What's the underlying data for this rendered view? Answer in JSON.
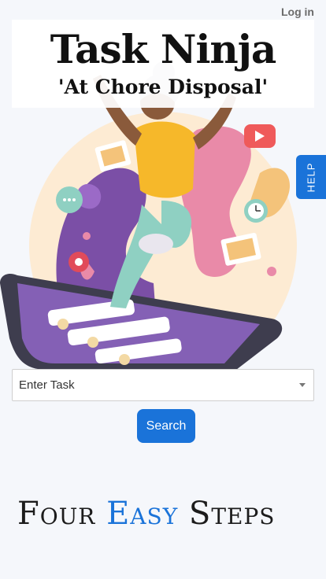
{
  "header": {
    "login_label": "Log in"
  },
  "hero": {
    "title": "Task Ninja",
    "subtitle": "'At Chore Disposal'"
  },
  "help_tab": {
    "label": "HELP"
  },
  "task_select": {
    "selected": "Enter Task"
  },
  "search": {
    "label": "Search"
  },
  "steps": {
    "word1": "Four",
    "word2": "Easy",
    "word3": "Steps"
  },
  "colors": {
    "accent": "#1a73d9",
    "hero_circle": "#fdebd3",
    "purple": "#7b4fa6",
    "pink": "#e98aa8",
    "shirt": "#f6b82a"
  }
}
